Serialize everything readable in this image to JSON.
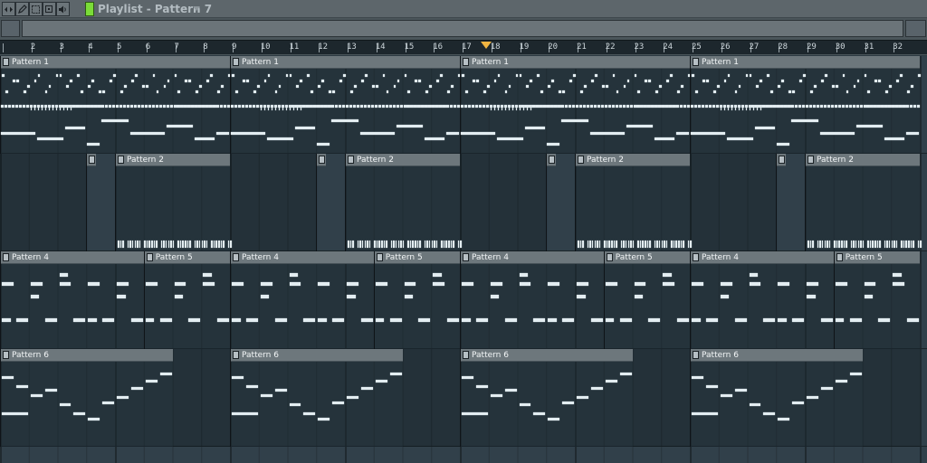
{
  "window": {
    "title": "Playlist - Pattern 7",
    "tools": [
      {
        "name": "mode-arrows-icon",
        "glyph": "◂▸"
      },
      {
        "name": "draw-tool-icon",
        "glyph": "✎"
      },
      {
        "name": "select-tool-icon",
        "glyph": "⬚"
      },
      {
        "name": "zoom-tool-icon",
        "glyph": "⊕"
      },
      {
        "name": "speaker-icon",
        "glyph": "🔈"
      }
    ]
  },
  "ruler": {
    "bars": [
      "1",
      "2",
      "3",
      "4",
      "5",
      "6",
      "7",
      "8",
      "9",
      "10",
      "11",
      "12",
      "13",
      "14",
      "15",
      "16",
      "17",
      "18",
      "19",
      "20",
      "21",
      "22",
      "23",
      "24",
      "25",
      "26",
      "27",
      "28",
      "29",
      "30",
      "31",
      "32"
    ],
    "playhead_bar": 16.9
  },
  "playlist": {
    "tracks": 5,
    "clips": [
      {
        "track": 0,
        "start": 0,
        "length": 8,
        "label": "Pattern 1",
        "style": "pattern1"
      },
      {
        "track": 0,
        "start": 8,
        "length": 8,
        "label": "Pattern 1",
        "style": "pattern1"
      },
      {
        "track": 0,
        "start": 16,
        "length": 8,
        "label": "Pattern 1",
        "style": "pattern1"
      },
      {
        "track": 0,
        "start": 24,
        "length": 8,
        "label": "Pattern 1",
        "style": "pattern1"
      },
      {
        "track": 1,
        "start": 3,
        "length": 1,
        "label": "",
        "style": "mini"
      },
      {
        "track": 1,
        "start": 4,
        "length": 4,
        "label": "Pattern 2",
        "style": "pattern2"
      },
      {
        "track": 1,
        "start": 11,
        "length": 1,
        "label": "",
        "style": "mini"
      },
      {
        "track": 1,
        "start": 12,
        "length": 4,
        "label": "Pattern 2",
        "style": "pattern2"
      },
      {
        "track": 1,
        "start": 19,
        "length": 1,
        "label": "",
        "style": "mini"
      },
      {
        "track": 1,
        "start": 20,
        "length": 4,
        "label": "Pattern 2",
        "style": "pattern2"
      },
      {
        "track": 1,
        "start": 27,
        "length": 1,
        "label": "",
        "style": "mini"
      },
      {
        "track": 1,
        "start": 28,
        "length": 4,
        "label": "Pattern 2",
        "style": "pattern2"
      },
      {
        "track": 2,
        "start": 0,
        "length": 5,
        "label": "Pattern 4",
        "style": "pattern4"
      },
      {
        "track": 2,
        "start": 5,
        "length": 3,
        "label": "Pattern 5",
        "style": "pattern5"
      },
      {
        "track": 2,
        "start": 8,
        "length": 5,
        "label": "Pattern 4",
        "style": "pattern4"
      },
      {
        "track": 2,
        "start": 13,
        "length": 3,
        "label": "Pattern 5",
        "style": "pattern5"
      },
      {
        "track": 2,
        "start": 16,
        "length": 5,
        "label": "Pattern 4",
        "style": "pattern4"
      },
      {
        "track": 2,
        "start": 21,
        "length": 3,
        "label": "Pattern 5",
        "style": "pattern5"
      },
      {
        "track": 2,
        "start": 24,
        "length": 5,
        "label": "Pattern 4",
        "style": "pattern4"
      },
      {
        "track": 2,
        "start": 29,
        "length": 3,
        "label": "Pattern 5",
        "style": "pattern5"
      },
      {
        "track": 3,
        "start": 0,
        "length": 6,
        "label": "Pattern 6",
        "style": "pattern6"
      },
      {
        "track": 3,
        "start": 8,
        "length": 6,
        "label": "Pattern 6",
        "style": "pattern6"
      },
      {
        "track": 3,
        "start": 16,
        "length": 6,
        "label": "Pattern 6",
        "style": "pattern6"
      },
      {
        "track": 3,
        "start": 24,
        "length": 6,
        "label": "Pattern 6",
        "style": "pattern6"
      }
    ]
  },
  "colors": {
    "grid_bg": "#31404a",
    "clip_header": "#6d777c",
    "note": "#e3edf1",
    "playhead": "#f0b441",
    "play_button": "#7bdc38",
    "title_text": "#b3bcc1"
  }
}
